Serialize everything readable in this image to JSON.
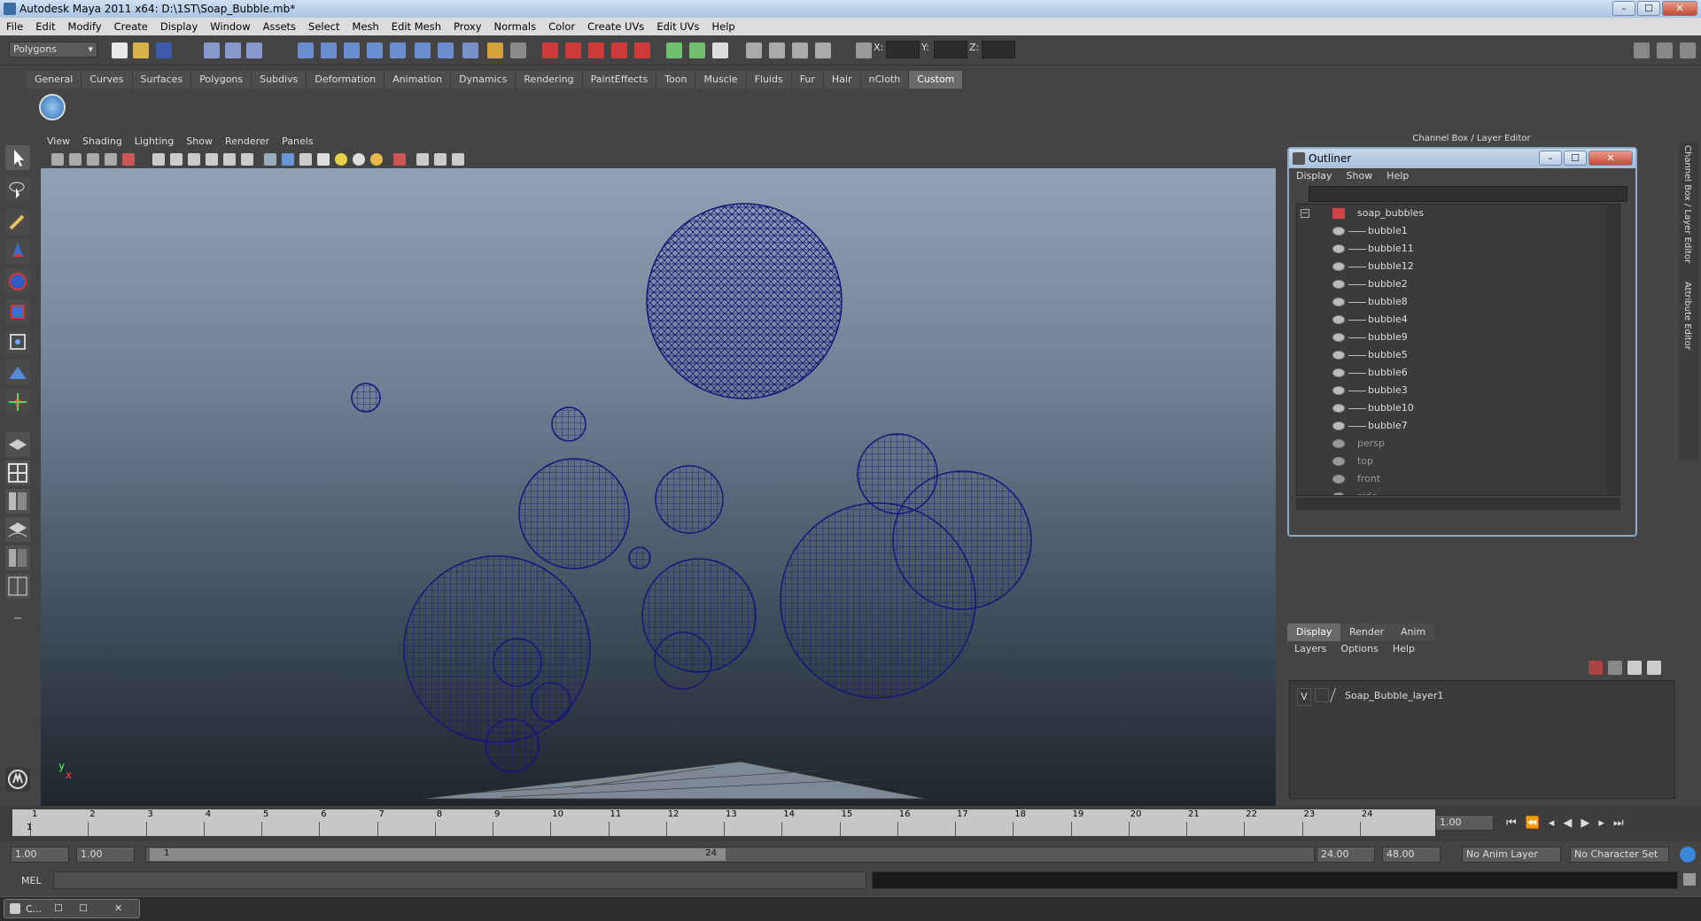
{
  "window": {
    "title": "Autodesk Maya 2011 x64: D:\\1ST\\Soap_Bubble.mb*",
    "btn_min": "–",
    "btn_max": "☐",
    "btn_close": "✕"
  },
  "menubar": [
    "File",
    "Edit",
    "Modify",
    "Create",
    "Display",
    "Window",
    "Assets",
    "Select",
    "Mesh",
    "Edit Mesh",
    "Proxy",
    "Normals",
    "Color",
    "Create UVs",
    "Edit UVs",
    "Help"
  ],
  "statusline": {
    "mode": "Polygons",
    "x_label": "X:",
    "y_label": "Y:",
    "z_label": "Z:"
  },
  "shelf": {
    "tabs": [
      "General",
      "Curves",
      "Surfaces",
      "Polygons",
      "Subdivs",
      "Deformation",
      "Animation",
      "Dynamics",
      "Rendering",
      "PaintEffects",
      "Toon",
      "Muscle",
      "Fluids",
      "Fur",
      "Hair",
      "nCloth",
      "Custom"
    ],
    "active": "Custom"
  },
  "panel_menu": [
    "View",
    "Shading",
    "Lighting",
    "Show",
    "Renderer",
    "Panels"
  ],
  "viewport": {
    "axis_y": "y",
    "axis_x": "x",
    "wire_color": "#16167a"
  },
  "channel_box_title": "Channel Box / Layer Editor",
  "side_tabs": {
    "channel": "Channel Box / Layer Editor",
    "attribute": "Attribute Editor"
  },
  "outliner": {
    "title": "Outliner",
    "menu": [
      "Display",
      "Show",
      "Help"
    ],
    "group": "soap_bubbles",
    "children": [
      "bubble1",
      "bubble11",
      "bubble12",
      "bubble2",
      "bubble8",
      "bubble4",
      "bubble9",
      "bubble5",
      "bubble6",
      "bubble3",
      "bubble10",
      "bubble7"
    ],
    "cameras": [
      "persp",
      "top",
      "front",
      "side"
    ]
  },
  "layer_editor": {
    "tabs": [
      "Display",
      "Render",
      "Anim"
    ],
    "active": "Display",
    "menu": [
      "Layers",
      "Options",
      "Help"
    ],
    "visible_flag": "V",
    "layer": "Soap_Bubble_layer1"
  },
  "timeline": {
    "frames": [
      "1",
      "2",
      "3",
      "4",
      "5",
      "6",
      "7",
      "8",
      "9",
      "10",
      "11",
      "12",
      "13",
      "14",
      "15",
      "16",
      "17",
      "18",
      "19",
      "20",
      "21",
      "22",
      "23",
      "24"
    ],
    "current_frame_label": "1",
    "current_time": "1.00"
  },
  "range": {
    "start": "1.00",
    "inner_start": "1.00",
    "bar_start": "1",
    "bar_end": "24",
    "end": "24.00",
    "total_end": "48.00",
    "anim_layer": "No Anim Layer",
    "char_set": "No Character Set"
  },
  "cmd": {
    "label": "MEL"
  },
  "taskbar": {
    "item": "C..."
  }
}
